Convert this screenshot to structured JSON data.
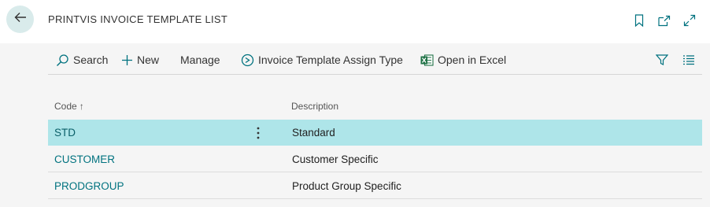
{
  "header": {
    "title": "PRINTVIS INVOICE TEMPLATE LIST",
    "back_icon": "arrow-left-icon",
    "bookmark_icon": "bookmark-icon",
    "open_new_icon": "open-in-new-window-icon",
    "expand_icon": "expand-icon"
  },
  "toolbar": {
    "search_label": "Search",
    "new_label": "New",
    "manage_label": "Manage",
    "assign_label": "Invoice Template Assign Type",
    "excel_label": "Open in Excel",
    "filter_icon": "filter-icon",
    "list_view_icon": "list-view-icon"
  },
  "columns": {
    "code": "Code",
    "sort_indicator": "↑",
    "description": "Description"
  },
  "rows": [
    {
      "code": "STD",
      "description": "Standard",
      "selected": true
    },
    {
      "code": "CUSTOMER",
      "description": "Customer Specific",
      "selected": false
    },
    {
      "code": "PRODGROUP",
      "description": "Product Group Specific",
      "selected": false
    }
  ],
  "colors": {
    "accent": "#00727f",
    "selected_row": "#aee5e9",
    "back_button_bg": "#d9ebeb",
    "excel_green": "#1e7145"
  }
}
